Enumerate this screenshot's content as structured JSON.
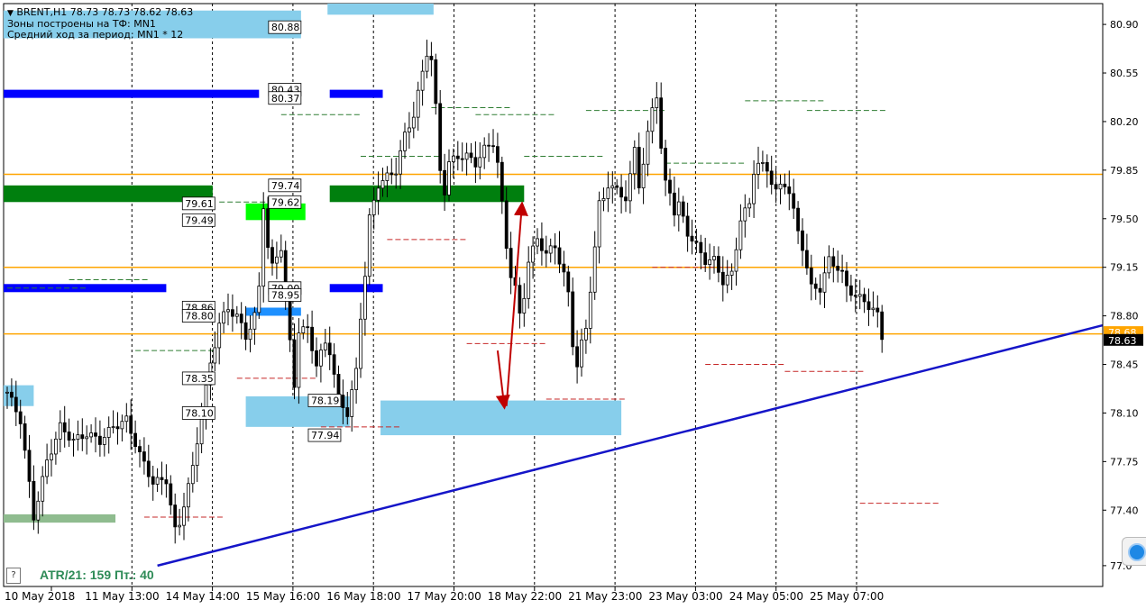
{
  "header": {
    "symbol_line": "BRENT,H1  78.73 78.73 78.62 78.63",
    "zones_line": "Зоны построены на ТФ: MN1",
    "range_line": "Средний ход за период: MN1 * 12"
  },
  "indicator": {
    "atr_text": "ATR/21: 159  Пт.: 40"
  },
  "help_button": "?",
  "colors": {
    "up_zone": "#87ceeb",
    "strong_support": "#007f0e",
    "bright_support": "#00ff00",
    "muted_support": "#8fbc8f",
    "blue_level": "#0000ff",
    "accent_level": "#ffa500",
    "trendline": "#1515c8",
    "arrow": "#c00000",
    "current_price": "#000000"
  },
  "chart_data": {
    "type": "candlestick",
    "symbol": "BRENT",
    "timeframe": "H1",
    "current_price": 78.63,
    "ask_price_partial": "78.68",
    "ylim": [
      76.85,
      81.05
    ],
    "y_ticks": [
      "80.90",
      "80.55",
      "80.20",
      "79.85",
      "79.50",
      "79.15",
      "78.80",
      "78.45",
      "78.10",
      "77.75",
      "77.40",
      "77.0"
    ],
    "x_ticks": [
      "10 May 2018",
      "11 May 13:00",
      "14 May 14:00",
      "15 May 16:00",
      "16 May 18:00",
      "17 May 20:00",
      "18 May 22:00",
      "21 May 23:00",
      "23 May 03:00",
      "24 May 05:00",
      "25 May 07:00"
    ],
    "close_path": [
      [
        0,
        78.25
      ],
      [
        3,
        78.05
      ],
      [
        6,
        77.35
      ],
      [
        9,
        77.75
      ],
      [
        12,
        78.0
      ],
      [
        15,
        77.9
      ],
      [
        18,
        77.95
      ],
      [
        21,
        77.9
      ],
      [
        24,
        78.0
      ],
      [
        27,
        78.05
      ],
      [
        30,
        77.8
      ],
      [
        33,
        77.6
      ],
      [
        36,
        77.62
      ],
      [
        38,
        77.25
      ],
      [
        39,
        77.3
      ],
      [
        40,
        77.45
      ],
      [
        42,
        77.7
      ],
      [
        44,
        78.1
      ],
      [
        46,
        78.45
      ],
      [
        48,
        78.75
      ],
      [
        50,
        78.85
      ],
      [
        52,
        78.8
      ],
      [
        54,
        78.65
      ],
      [
        56,
        78.8
      ],
      [
        57,
        79.0
      ],
      [
        58,
        79.6
      ],
      [
        59,
        79.3
      ],
      [
        60,
        79.15
      ],
      [
        62,
        79.3
      ],
      [
        64,
        78.6
      ],
      [
        65,
        78.3
      ],
      [
        66,
        78.7
      ],
      [
        68,
        78.7
      ],
      [
        70,
        78.45
      ],
      [
        72,
        78.6
      ],
      [
        73,
        78.55
      ],
      [
        75,
        78.2
      ],
      [
        77,
        78.1
      ],
      [
        79,
        78.4
      ],
      [
        80,
        78.8
      ],
      [
        81,
        79.1
      ],
      [
        82,
        79.5
      ],
      [
        84,
        79.75
      ],
      [
        86,
        79.8
      ],
      [
        88,
        79.85
      ],
      [
        90,
        80.1
      ],
      [
        92,
        80.25
      ],
      [
        94,
        80.55
      ],
      [
        95,
        80.7
      ],
      [
        96,
        80.65
      ],
      [
        97,
        80.3
      ],
      [
        98,
        79.85
      ],
      [
        99,
        79.7
      ],
      [
        100,
        79.9
      ],
      [
        102,
        79.95
      ],
      [
        104,
        79.95
      ],
      [
        106,
        79.9
      ],
      [
        108,
        80.0
      ],
      [
        110,
        80.05
      ],
      [
        111,
        79.9
      ],
      [
        112,
        79.6
      ],
      [
        113,
        79.3
      ],
      [
        114,
        79.1
      ],
      [
        115,
        79.0
      ],
      [
        116,
        78.8
      ],
      [
        117,
        78.95
      ],
      [
        118,
        79.2
      ],
      [
        120,
        79.35
      ],
      [
        122,
        79.25
      ],
      [
        124,
        79.3
      ],
      [
        126,
        79.1
      ],
      [
        127,
        78.95
      ],
      [
        128,
        78.6
      ],
      [
        129,
        78.45
      ],
      [
        130,
        78.6
      ],
      [
        131,
        78.7
      ],
      [
        132,
        79.0
      ],
      [
        133,
        79.3
      ],
      [
        134,
        79.6
      ],
      [
        135,
        79.65
      ],
      [
        136,
        79.75
      ],
      [
        138,
        79.7
      ],
      [
        140,
        79.65
      ],
      [
        141,
        79.8
      ],
      [
        142,
        80.0
      ],
      [
        143,
        79.75
      ],
      [
        144,
        79.9
      ],
      [
        146,
        80.3
      ],
      [
        147,
        80.4
      ],
      [
        148,
        80.0
      ],
      [
        149,
        79.75
      ],
      [
        150,
        79.7
      ],
      [
        151,
        79.55
      ],
      [
        152,
        79.6
      ],
      [
        154,
        79.4
      ],
      [
        156,
        79.3
      ],
      [
        158,
        79.2
      ],
      [
        160,
        79.2
      ],
      [
        162,
        79.05
      ],
      [
        164,
        79.1
      ],
      [
        165,
        79.3
      ],
      [
        166,
        79.5
      ],
      [
        168,
        79.6
      ],
      [
        169,
        79.85
      ],
      [
        170,
        79.9
      ],
      [
        172,
        79.85
      ],
      [
        174,
        79.7
      ],
      [
        176,
        79.75
      ],
      [
        177,
        79.7
      ],
      [
        178,
        79.55
      ],
      [
        179,
        79.4
      ],
      [
        180,
        79.3
      ],
      [
        182,
        79.0
      ],
      [
        184,
        79.0
      ],
      [
        186,
        79.2
      ],
      [
        188,
        79.15
      ],
      [
        189,
        79.1
      ],
      [
        190,
        79.0
      ],
      [
        192,
        78.95
      ],
      [
        194,
        78.9
      ],
      [
        196,
        78.85
      ],
      [
        197,
        78.8
      ],
      [
        198,
        78.63
      ]
    ],
    "zones": [
      {
        "kind": "resistance",
        "y": [
          80.8,
          81.0
        ],
        "x": [
          0,
          66.5
        ]
      },
      {
        "kind": "resistance",
        "y": [
          80.97,
          81.2
        ],
        "x": [
          72.5,
          96.5
        ]
      },
      {
        "kind": "resistance",
        "y": [
          78.15,
          78.3
        ],
        "x": [
          0,
          6.0
        ]
      },
      {
        "kind": "support",
        "y": [
          78.0,
          78.22
        ],
        "x": [
          54,
          77.5
        ]
      },
      {
        "kind": "support",
        "y": [
          77.94,
          78.19
        ],
        "x": [
          84.5,
          139
        ]
      },
      {
        "kind": "strong_support",
        "y": [
          79.62,
          79.74
        ],
        "x": [
          0,
          46.5
        ]
      },
      {
        "kind": "strong_support",
        "y": [
          79.62,
          79.74
        ],
        "x": [
          73,
          117
        ]
      },
      {
        "kind": "bright_support",
        "y": [
          79.49,
          79.61
        ],
        "x": [
          54,
          67.5
        ]
      },
      {
        "kind": "muted_support",
        "y": [
          77.31,
          77.37
        ],
        "x": [
          0,
          24.5
        ]
      }
    ],
    "levels": [
      {
        "kind": "blue_thick",
        "price": 80.4,
        "x": [
          0,
          57
        ]
      },
      {
        "kind": "blue_thick",
        "price": 80.4,
        "x": [
          73,
          85
        ]
      },
      {
        "kind": "blue_thick",
        "price": 79.0,
        "x": [
          0,
          36
        ]
      },
      {
        "kind": "blue_thick",
        "price": 79.0,
        "x": [
          73,
          85
        ]
      },
      {
        "kind": "light_blue",
        "price": 78.83,
        "x": [
          54,
          66.5
        ]
      },
      {
        "kind": "orange",
        "price": 79.82
      },
      {
        "kind": "orange",
        "price": 79.15
      },
      {
        "kind": "orange",
        "price": 78.67
      }
    ],
    "level_labels": [
      "80.88",
      "80.43",
      "80.37",
      "79.74",
      "79.62",
      "79.61",
      "79.49",
      "79.00",
      "78.95",
      "78.86",
      "78.80",
      "78.35",
      "78.10",
      "78.19",
      "77.94"
    ],
    "trendline": {
      "from": [
        34,
        77.0
      ],
      "to": [
        139,
        77.85
      ]
    },
    "forecast_arrows": [
      {
        "from": [
          111,
          78.55
        ],
        "to": [
          112.5,
          78.15
        ]
      },
      {
        "from": [
          113,
          78.15
        ],
        "to": [
          116.5,
          79.6
        ]
      }
    ]
  }
}
